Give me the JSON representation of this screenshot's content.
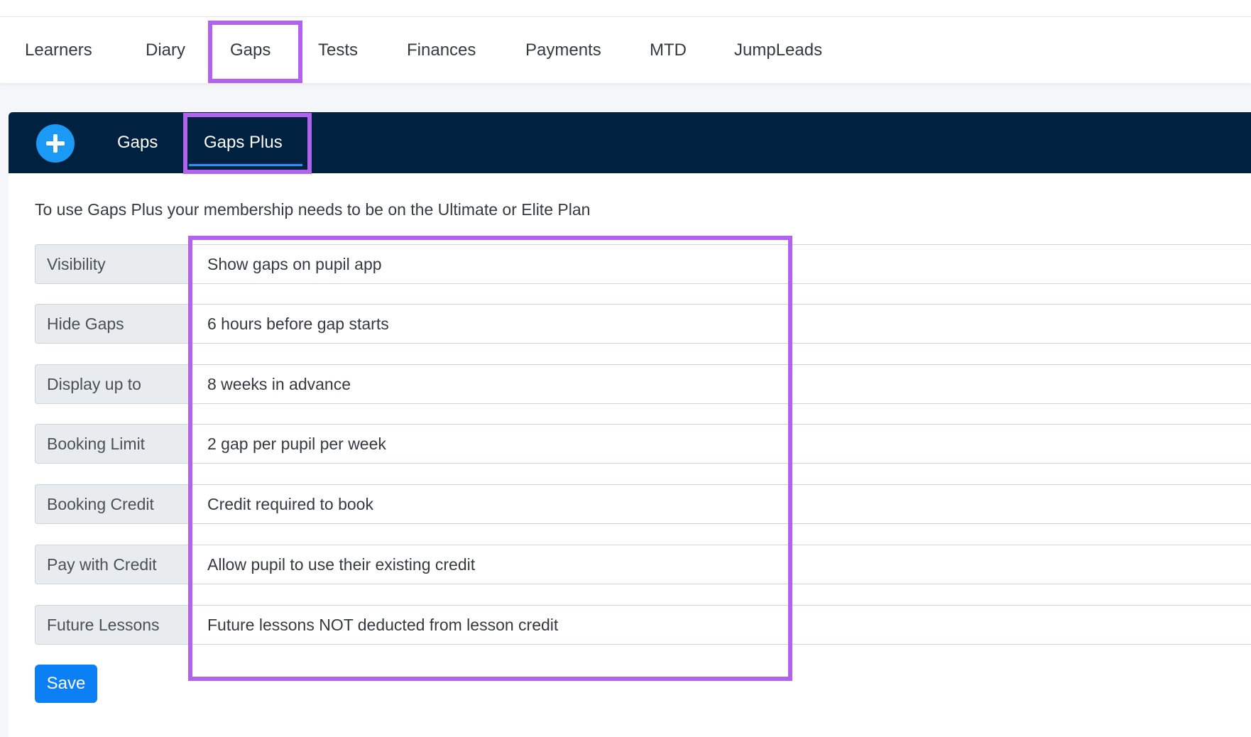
{
  "topnav": {
    "items": [
      "Learners",
      "Diary",
      "Gaps",
      "Tests",
      "Finances",
      "Payments",
      "MTD",
      "JumpLeads"
    ],
    "active": "Gaps"
  },
  "subnav": {
    "add_icon": "plus-icon",
    "tabs": [
      "Gaps",
      "Gaps Plus"
    ],
    "active": "Gaps Plus",
    "header_color": "#012141"
  },
  "intro_text": "To use Gaps Plus your membership needs to be on the Ultimate or Elite Plan",
  "settings": [
    {
      "label": "Visibility",
      "value": "Show gaps on pupil app"
    },
    {
      "label": "Hide Gaps",
      "value": "6 hours before gap starts"
    },
    {
      "label": "Display up to",
      "value": "8 weeks in advance"
    },
    {
      "label": "Booking Limit",
      "value": "2 gap per pupil per week"
    },
    {
      "label": "Booking Credit",
      "value": "Credit required to book"
    },
    {
      "label": "Pay with Credit",
      "value": "Allow pupil to use their existing credit"
    },
    {
      "label": "Future Lessons",
      "value": "Future lessons NOT deducted from lesson credit"
    }
  ],
  "save_label": "Save",
  "colors": {
    "highlight": "#b262ef",
    "save_button": "#0d7ff5",
    "add_button": "#1a9af5"
  }
}
